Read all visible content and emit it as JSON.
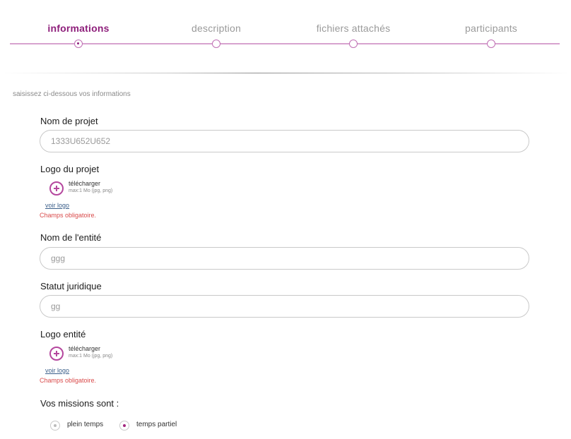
{
  "stepper": {
    "steps": [
      {
        "label": "informations",
        "active": true
      },
      {
        "label": "description",
        "active": false
      },
      {
        "label": "fichiers attachés",
        "active": false
      },
      {
        "label": "participants",
        "active": false
      }
    ],
    "accent_color": "#8e1f7b",
    "line_color": "#d7a3cf"
  },
  "form": {
    "intro": "saisissez ci-dessous vos informations",
    "project_name": {
      "label": "Nom de projet",
      "value": "1333U652U652"
    },
    "project_logo": {
      "label": "Logo du projet",
      "upload_label": "télécharger",
      "upload_hint": "max:1 Mo (jpg, png)",
      "view_link": "voir logo",
      "required_message": "Champs obligatoire."
    },
    "entity_name": {
      "label": "Nom de l'entité",
      "value": "ggg"
    },
    "legal_status": {
      "label": "Statut juridique",
      "value": "gg"
    },
    "entity_logo": {
      "label": "Logo entité",
      "upload_label": "télécharger",
      "upload_hint": "max:1 Mo (jpg, png)",
      "view_link": "voir logo",
      "required_message": "Champs obligatoire."
    },
    "missions": {
      "label": "Vos missions sont :",
      "options": [
        {
          "label": "plein temps",
          "checked": false
        },
        {
          "label": "temps partiel",
          "checked": true
        }
      ]
    }
  },
  "colors": {
    "required_text": "#d94a4a",
    "link": "#3b5f8a",
    "upload_icon": "#b5479e"
  }
}
